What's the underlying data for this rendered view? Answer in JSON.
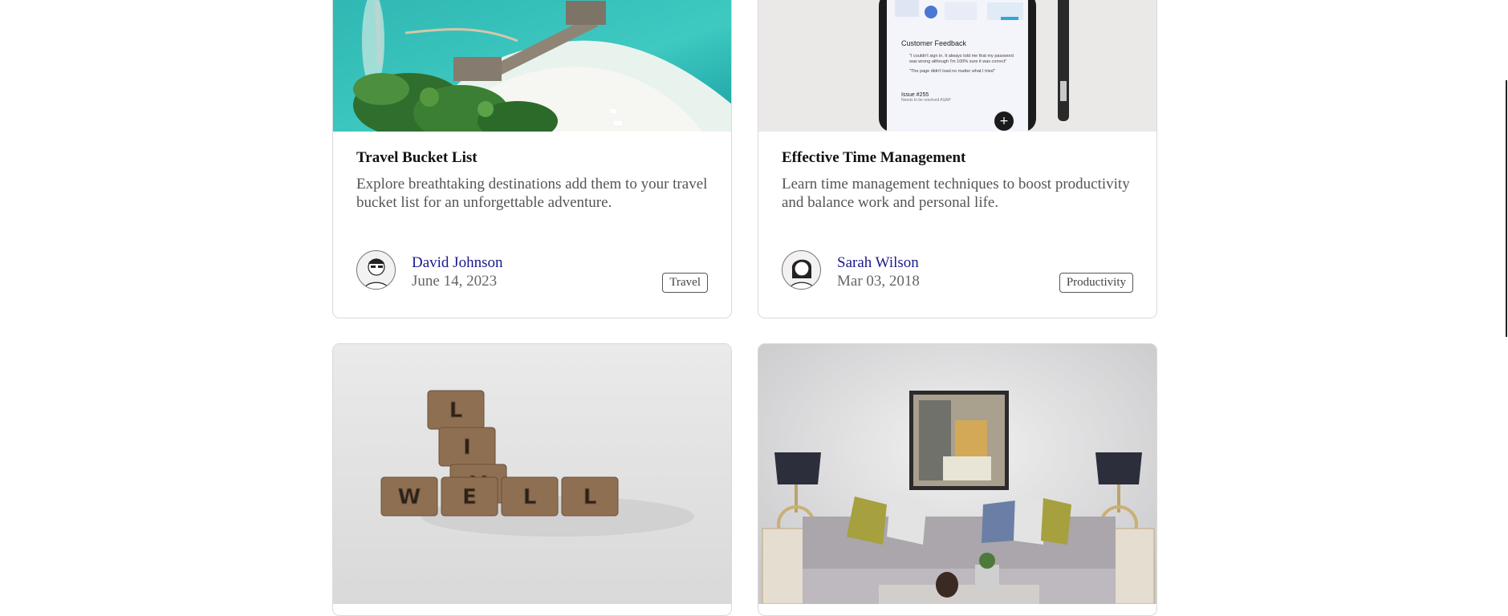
{
  "cards": [
    {
      "title": "Travel Bucket List",
      "description": "Explore breathtaking destinations add them to your travel bucket list for an unforgettable adventure.",
      "author": "David Johnson",
      "date": "June 14, 2023",
      "tag": "Travel"
    },
    {
      "title": "Effective Time Management",
      "description": "Learn time management techniques to boost productivity and balance work and personal life.",
      "author": "Sarah Wilson",
      "date": "Mar 03, 2018",
      "tag": "Productivity"
    }
  ],
  "phone_screen": {
    "heading": "Customer Feedback",
    "bullets": [
      "\"I couldn't sign in. It always told me that my password was wrong although I'm 100% sure it was correct\"",
      "\"The page didn't load no matter what I tried\""
    ],
    "issue": "Issue #255",
    "issue_sub": "Needs to be resolved ASAP"
  },
  "scrabble_letters": [
    "L",
    "I",
    "V",
    "W",
    "E",
    "L",
    "L"
  ],
  "colors": {
    "author_link": "#1a1a8c",
    "card_border": "#d9d9d9",
    "muted_text": "#555555"
  }
}
